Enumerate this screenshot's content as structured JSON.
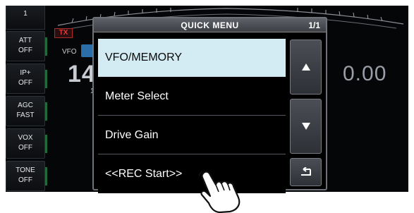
{
  "left_functions": [
    {
      "name": "ATT",
      "value": "OFF"
    },
    {
      "name": "IP+",
      "value": "OFF"
    },
    {
      "name": "AGC",
      "value": "FAST"
    },
    {
      "name": "VOX",
      "value": "OFF"
    },
    {
      "name": "TONE",
      "value": "OFF"
    }
  ],
  "top_stub": {
    "value": "1"
  },
  "status": {
    "tx": "TX",
    "vfo": "VFO"
  },
  "frequency": {
    "left_digits": "14",
    "right_digits": "0.00",
    "sub": "1"
  },
  "quick_menu": {
    "title": "QUICK MENU",
    "page": "1/1",
    "items": [
      {
        "label": "VFO/MEMORY",
        "selected": true
      },
      {
        "label": "Meter Select",
        "selected": false
      },
      {
        "label": "Drive Gain",
        "selected": false
      },
      {
        "label": "<<REC Start>>",
        "selected": false
      }
    ],
    "buttons": {
      "up_icon": "triangle-up-icon",
      "down_icon": "triangle-down-icon",
      "return_icon": "return-arrow-icon"
    }
  },
  "colors": {
    "selected_bg": "#d3ecf3",
    "tx_red": "#e03a3a",
    "vfo_blue": "#2b6ea8"
  }
}
